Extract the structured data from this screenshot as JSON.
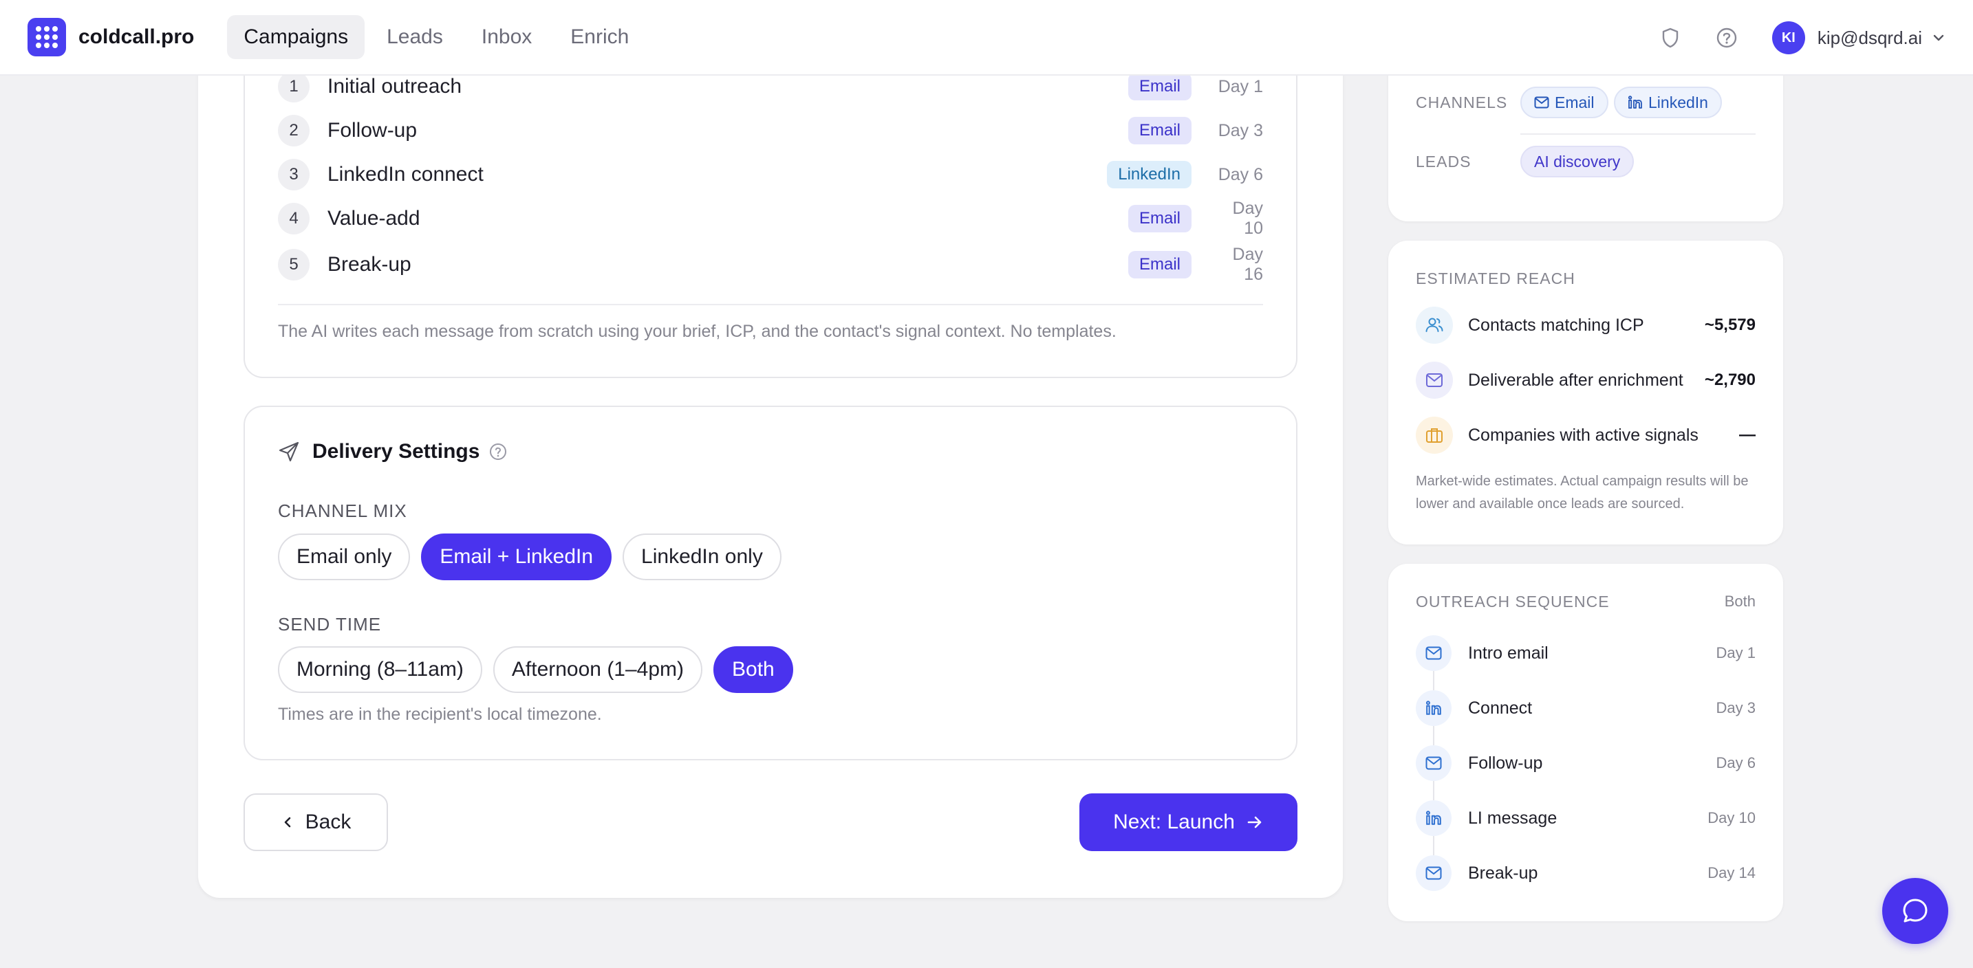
{
  "brand": {
    "name": "coldcall.pro"
  },
  "nav": {
    "items": [
      {
        "label": "Campaigns",
        "active": true
      },
      {
        "label": "Leads",
        "active": false
      },
      {
        "label": "Inbox",
        "active": false
      },
      {
        "label": "Enrich",
        "active": false
      }
    ]
  },
  "user": {
    "initials": "KI",
    "email": "kip@dsqrd.ai"
  },
  "sequence": {
    "steps": [
      {
        "num": "1",
        "title": "Initial outreach",
        "channel": "Email",
        "day": "Day 1"
      },
      {
        "num": "2",
        "title": "Follow-up",
        "channel": "Email",
        "day": "Day 3"
      },
      {
        "num": "3",
        "title": "LinkedIn connect",
        "channel": "LinkedIn",
        "day": "Day 6"
      },
      {
        "num": "4",
        "title": "Value-add",
        "channel": "Email",
        "day": "Day 10"
      },
      {
        "num": "5",
        "title": "Break-up",
        "channel": "Email",
        "day": "Day 16"
      }
    ],
    "note": "The AI writes each message from scratch using your brief, ICP, and the contact's signal context. No templates."
  },
  "delivery": {
    "title": "Delivery Settings",
    "channel_mix_label": "CHANNEL MIX",
    "channel_mix_options": [
      "Email only",
      "Email + LinkedIn",
      "LinkedIn only"
    ],
    "channel_mix_selected": "Email + LinkedIn",
    "send_time_label": "SEND TIME",
    "send_time_options": [
      "Morning (8–11am)",
      "Afternoon (1–4pm)",
      "Both"
    ],
    "send_time_selected": "Both",
    "tz_note": "Times are in the recipient's local timezone."
  },
  "actions": {
    "back": "Back",
    "next": "Next: Launch"
  },
  "summary": {
    "channels_label": "CHANNELS",
    "channels": [
      "Email",
      "LinkedIn"
    ],
    "leads_label": "LEADS",
    "leads": "AI discovery"
  },
  "reach": {
    "label": "ESTIMATED REACH",
    "rows": [
      {
        "label": "Contacts matching ICP",
        "value": "~5,579",
        "icon": "users-icon"
      },
      {
        "label": "Deliverable after enrichment",
        "value": "~2,790",
        "icon": "mail-icon"
      },
      {
        "label": "Companies with active signals",
        "value": "—",
        "icon": "briefcase-icon"
      }
    ],
    "note": "Market-wide estimates. Actual campaign results will be lower and available once leads are sourced."
  },
  "outreach": {
    "label": "OUTREACH SEQUENCE",
    "mode": "Both",
    "items": [
      {
        "label": "Intro email",
        "day": "Day 1",
        "icon": "mail-icon"
      },
      {
        "label": "Connect",
        "day": "Day 3",
        "icon": "linkedin-icon"
      },
      {
        "label": "Follow-up",
        "day": "Day 6",
        "icon": "mail-icon"
      },
      {
        "label": "LI message",
        "day": "Day 10",
        "icon": "linkedin-icon"
      },
      {
        "label": "Break-up",
        "day": "Day 14",
        "icon": "mail-icon"
      }
    ]
  },
  "colors": {
    "accent": "#4a33ee",
    "email_chip": "#e4e4fb",
    "linkedin_chip": "#ddeefb"
  }
}
